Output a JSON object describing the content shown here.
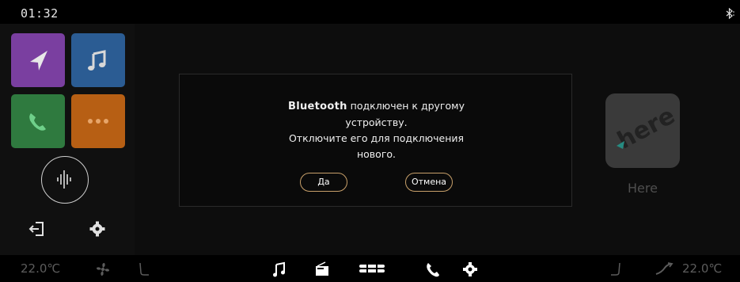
{
  "status": {
    "time": "01:32",
    "bluetooth_icon": "bluetooth-icon"
  },
  "dock": {
    "apps": [
      {
        "name": "navigation",
        "icon": "navigation-arrow-icon",
        "color": "#7a3fa0"
      },
      {
        "name": "music",
        "icon": "music-note-icon",
        "color": "#2b5c93"
      },
      {
        "name": "phone",
        "icon": "phone-icon",
        "color": "#2f7a3f"
      },
      {
        "name": "more",
        "icon": "more-dots-icon",
        "color": "#b75f14"
      }
    ],
    "voice_icon": "voice-waveform-icon",
    "exit_icon": "exit-icon",
    "settings_icon": "gear-icon"
  },
  "dialog": {
    "brand": "Bluetooth",
    "line1_rest": " подключен к другому",
    "line2": "устройству.",
    "line3": "Отключите его для подключения",
    "line4": "нового.",
    "yes_label": "Да",
    "cancel_label": "Отмена",
    "accent": "#c8a06a"
  },
  "right_app": {
    "label": "Here",
    "logo_text": "here"
  },
  "bottom_bar": {
    "temp_left": "22.0℃",
    "temp_right": "22.0℃",
    "icons": [
      "fan-icon",
      "seat-heat-left-icon",
      "music-icon",
      "radio-icon",
      "car-grid-icon",
      "phone-icon",
      "gear-icon",
      "seat-heat-right-icon",
      "airflow-icon"
    ]
  }
}
